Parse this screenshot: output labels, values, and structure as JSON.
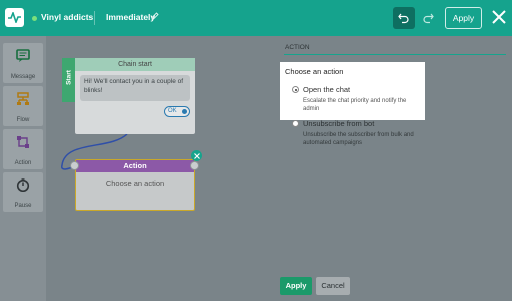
{
  "header": {
    "brand": "Vinyl addicts",
    "flow_name": "Immediately",
    "apply_label": "Apply",
    "colors": {
      "header": "#15a38d",
      "status_dot": "#7be07b"
    }
  },
  "sidebar": {
    "items": [
      {
        "label": "Message",
        "icon": "message-icon"
      },
      {
        "label": "Flow",
        "icon": "flow-icon"
      },
      {
        "label": "Action",
        "icon": "action-icon"
      },
      {
        "label": "Pause",
        "icon": "pause-icon"
      }
    ]
  },
  "canvas": {
    "start_tab": "Start",
    "chain_start": {
      "title": "Chain start",
      "message": "Hi! We'll contact you in a couple of blinks!",
      "button": "OK"
    },
    "action_card": {
      "title": "Action",
      "placeholder": "Choose an action"
    }
  },
  "panel": {
    "title": "ACTION",
    "choose_label": "Choose an action",
    "options": [
      {
        "label": "Open the chat",
        "description": "Escalate the chat priority and notify the admin",
        "selected": true
      },
      {
        "label": "Unsubscribe from bot",
        "description": "Unsubscribe the subscriber from bulk and automated campaigns",
        "selected": false
      }
    ],
    "apply_label": "Apply",
    "cancel_label": "Cancel"
  }
}
